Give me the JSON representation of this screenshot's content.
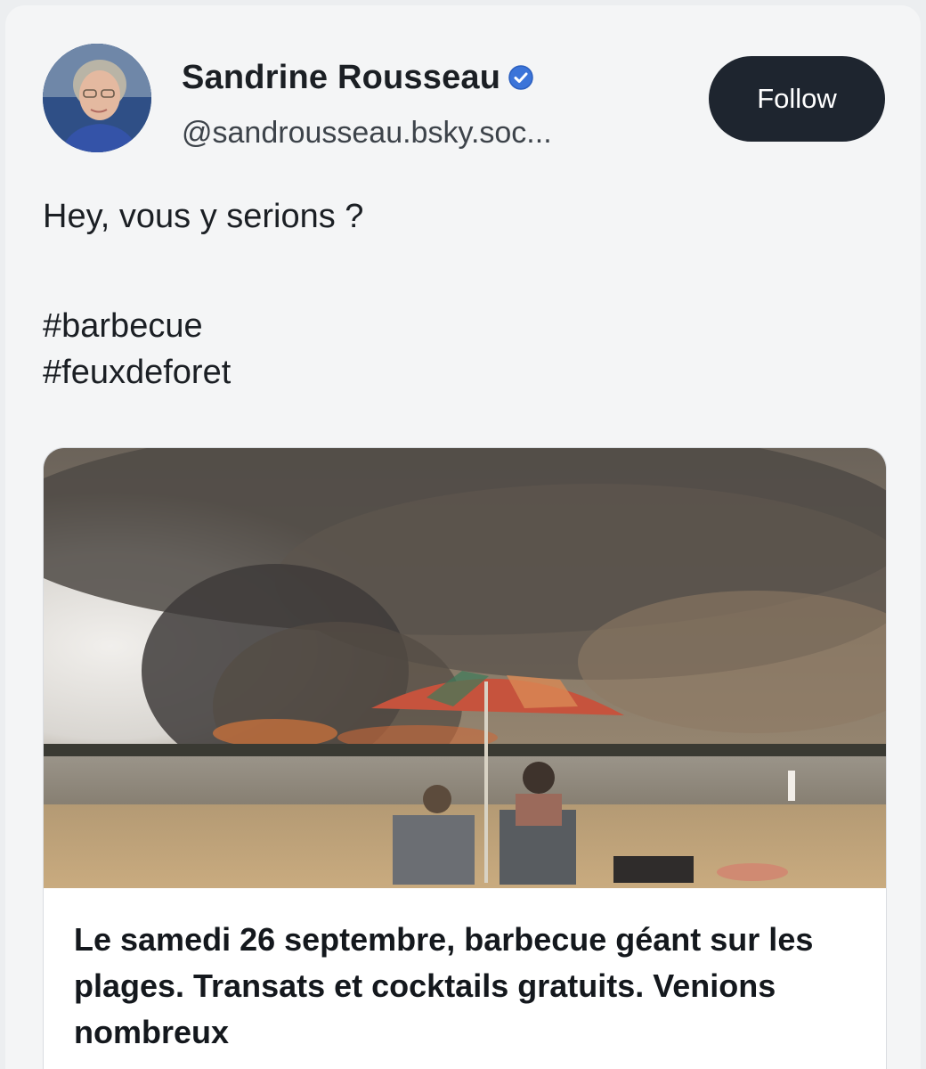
{
  "post": {
    "author": {
      "name": "Sandrine Rousseau",
      "handle": "@sandrousseau.bsky.soc...",
      "verified": true
    },
    "follow_label": "Follow",
    "text_line": "Hey, vous y serions ?",
    "hashtags": [
      "#barbecue",
      "#feuxdeforet"
    ]
  },
  "embed": {
    "title": "Le samedi 26 septembre, barbecue géant sur les plages. Transats et cocktails gratuits. Venions nombreux"
  },
  "colors": {
    "follow_button": "#1e252f",
    "verified_badge": "#3b74d9",
    "text": "#1b1f24"
  }
}
